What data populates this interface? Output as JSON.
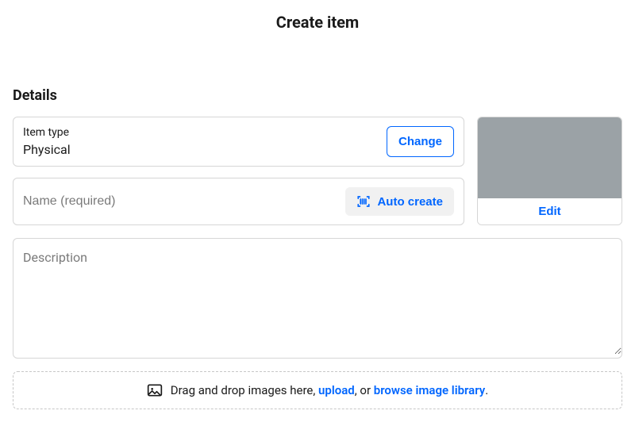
{
  "page_title": "Create item",
  "section_title": "Details",
  "item_type": {
    "label": "Item type",
    "value": "Physical",
    "change_label": "Change"
  },
  "name_field": {
    "placeholder": "Name (required)",
    "value": "",
    "auto_create_label": "Auto create"
  },
  "image_card": {
    "edit_label": "Edit"
  },
  "description": {
    "placeholder": "Description",
    "value": ""
  },
  "dropzone": {
    "text_prefix": "Drag and drop images here, ",
    "upload_label": "upload",
    "text_mid": ", or ",
    "browse_label": "browse image library",
    "text_suffix": "."
  }
}
